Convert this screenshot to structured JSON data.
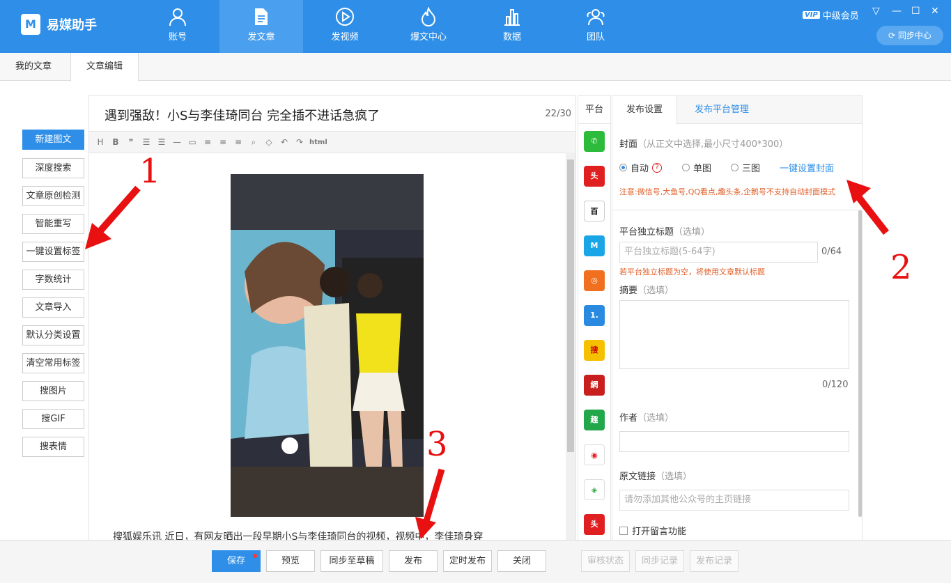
{
  "app": {
    "logo_mark": "M",
    "name": "易媒助手"
  },
  "nav": [
    {
      "label": "账号",
      "icon": "user-icon"
    },
    {
      "label": "发文章",
      "icon": "document-icon",
      "active": true
    },
    {
      "label": "发视频",
      "icon": "play-icon"
    },
    {
      "label": "爆文中心",
      "icon": "flame-icon"
    },
    {
      "label": "数据",
      "icon": "bar-chart-icon"
    },
    {
      "label": "团队",
      "icon": "team-icon"
    }
  ],
  "account": {
    "vip_badge": "VIP",
    "level": "中级会员",
    "sync_label": "同步中心"
  },
  "window": {
    "dropdown": "▽",
    "minimize": "—",
    "maximize": "☐",
    "close": "✕"
  },
  "tabs": {
    "my_articles": "我的文章",
    "edit_article": "文章编辑"
  },
  "left_tools": [
    "新建图文",
    "深度搜索",
    "文章原创检测",
    "智能重写",
    "一键设置标签",
    "字数统计",
    "文章导入",
    "默认分类设置",
    "清空常用标签",
    "搜图片",
    "搜GIF",
    "搜表情"
  ],
  "editor": {
    "title": "遇到强敌！小S与李佳琦同台 完全插不进话急疯了",
    "title_count": "22/30",
    "toolbar_html": "html",
    "body_text": "搜狐娱乐讯 近日，有网友晒出一段早期小S与李佳琦同台的视频，视频中，李佳琦身穿"
  },
  "platforms": {
    "header": "平台"
  },
  "panel": {
    "tab_settings": "发布设置",
    "tab_platform_mgmt": "发布平台管理",
    "cover_label": "封面",
    "cover_hint": "（从正文中选择,最小尺寸400*300）",
    "radio_auto": "自动",
    "radio_single": "单图",
    "radio_three": "三图",
    "one_click_cover": "一键设置封面",
    "cover_warning": "注意:微信号,大鱼号,QQ看点,趣头条,企鹅号不支持自动封面模式",
    "title_label": "平台独立标题",
    "optional": "（选填）",
    "title_placeholder": "平台独立标题(5-64字)",
    "title_count": "0/64",
    "title_warning": "若平台独立标题为空，将使用文章默认标题",
    "summary_label": "摘要",
    "summary_count": "0/120",
    "author_label": "作者",
    "link_label": "原文链接",
    "link_placeholder": "请勿添加其他公众号的主页链接",
    "comment_label": "打开留言功能"
  },
  "bottom": {
    "save": "保存",
    "preview": "预览",
    "sync_draft": "同步至草稿",
    "publish": "发布",
    "schedule": "定时发布",
    "close": "关闭",
    "review_status": "审核状态",
    "sync_record": "同步记录",
    "publish_record": "发布记录"
  },
  "annotations": {
    "n1": "1",
    "n2": "2",
    "n3": "3"
  },
  "colors": {
    "brand": "#2f8fe8",
    "annotation": "#e81010",
    "warning": "#e0602a"
  }
}
